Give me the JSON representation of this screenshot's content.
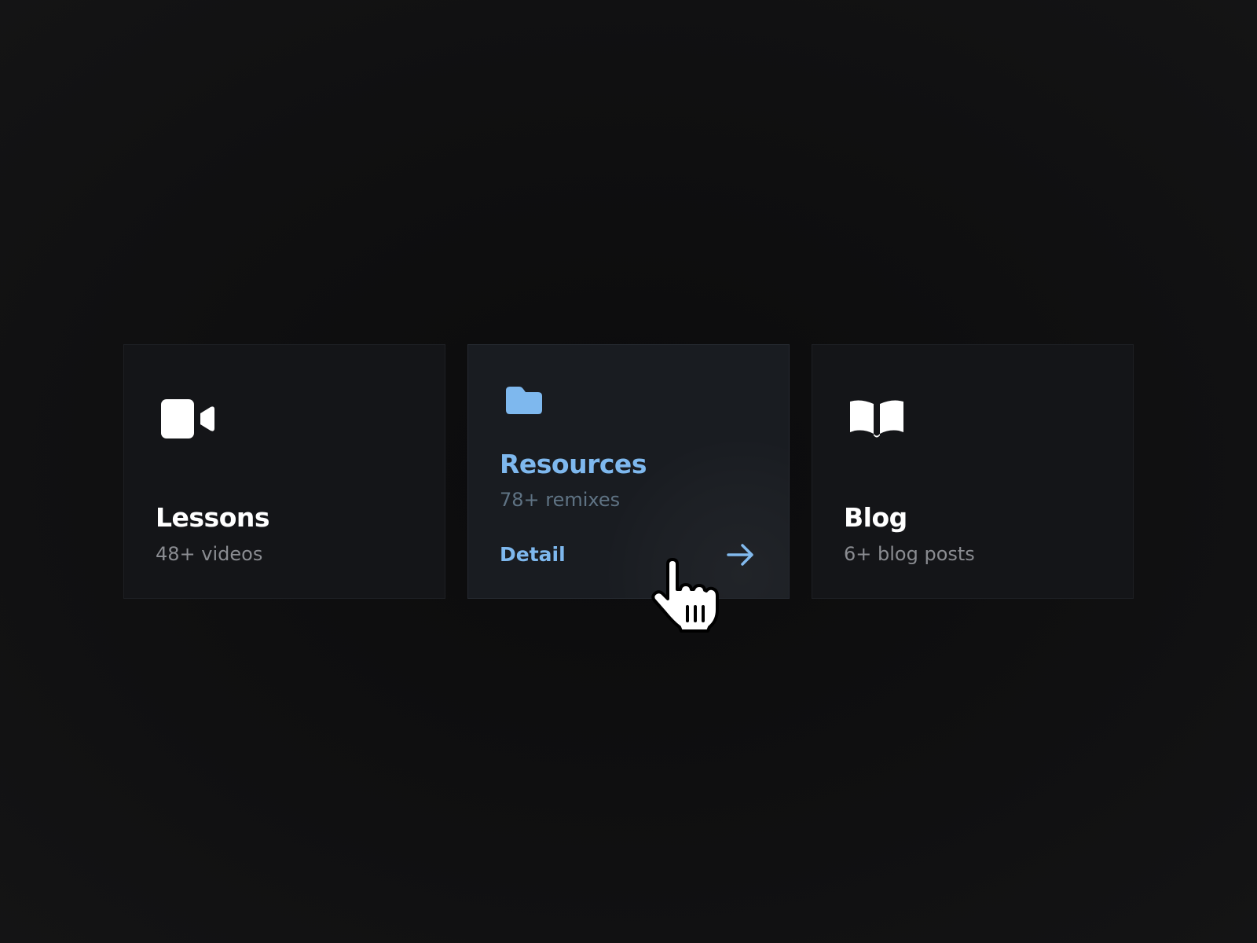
{
  "cards": [
    {
      "title": "Lessons",
      "subtitle": "48+ videos",
      "icon": "video-camera-icon"
    },
    {
      "title": "Resources",
      "subtitle": "78+ remixes",
      "icon": "folder-icon",
      "link_label": "Detail",
      "link_icon": "arrow-right-icon"
    },
    {
      "title": "Blog",
      "subtitle": "6+ blog posts",
      "icon": "open-book-icon"
    }
  ],
  "colors": {
    "accent": "#7eb8ee",
    "card_background": "#141518",
    "card_active_background": "#191c21",
    "page_background": "#0f0f10",
    "muted_text": "#8a8c91"
  },
  "cursor": "hand-pointer-cursor"
}
